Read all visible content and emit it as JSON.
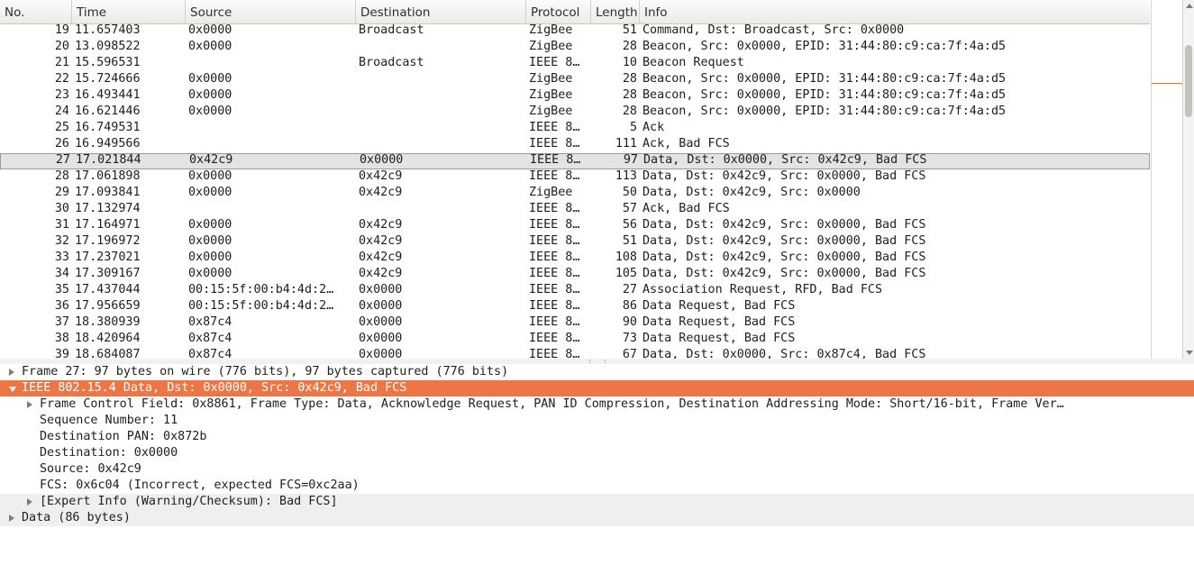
{
  "columns": {
    "no": "No.",
    "time": "Time",
    "source": "Source",
    "destination": "Destination",
    "protocol": "Protocol",
    "length": "Length",
    "info": "Info"
  },
  "packets": [
    {
      "no": "19",
      "time": "11.657403",
      "src": "0x0000",
      "dst": "Broadcast",
      "proto": "ZigBee",
      "len": "51",
      "info": "Command, Dst: Broadcast, Src: 0x0000"
    },
    {
      "no": "20",
      "time": "13.098522",
      "src": "0x0000",
      "dst": "",
      "proto": "ZigBee",
      "len": "28",
      "info": "Beacon, Src: 0x0000, EPID: 31:44:80:c9:ca:7f:4a:d5"
    },
    {
      "no": "21",
      "time": "15.596531",
      "src": "",
      "dst": "Broadcast",
      "proto": "IEEE 8…",
      "len": "10",
      "info": "Beacon Request"
    },
    {
      "no": "22",
      "time": "15.724666",
      "src": "0x0000",
      "dst": "",
      "proto": "ZigBee",
      "len": "28",
      "info": "Beacon, Src: 0x0000, EPID: 31:44:80:c9:ca:7f:4a:d5"
    },
    {
      "no": "23",
      "time": "16.493441",
      "src": "0x0000",
      "dst": "",
      "proto": "ZigBee",
      "len": "28",
      "info": "Beacon, Src: 0x0000, EPID: 31:44:80:c9:ca:7f:4a:d5"
    },
    {
      "no": "24",
      "time": "16.621446",
      "src": "0x0000",
      "dst": "",
      "proto": "ZigBee",
      "len": "28",
      "info": "Beacon, Src: 0x0000, EPID: 31:44:80:c9:ca:7f:4a:d5"
    },
    {
      "no": "25",
      "time": "16.749531",
      "src": "",
      "dst": "",
      "proto": "IEEE 8…",
      "len": "5",
      "info": "Ack"
    },
    {
      "no": "26",
      "time": "16.949566",
      "src": "",
      "dst": "",
      "proto": "IEEE 8…",
      "len": "111",
      "info": "Ack, Bad FCS"
    },
    {
      "no": "27",
      "time": "17.021844",
      "src": "0x42c9",
      "dst": "0x0000",
      "proto": "IEEE 8…",
      "len": "97",
      "info": "Data, Dst: 0x0000, Src: 0x42c9, Bad FCS",
      "selected": true
    },
    {
      "no": "28",
      "time": "17.061898",
      "src": "0x0000",
      "dst": "0x42c9",
      "proto": "IEEE 8…",
      "len": "113",
      "info": "Data, Dst: 0x42c9, Src: 0x0000, Bad FCS"
    },
    {
      "no": "29",
      "time": "17.093841",
      "src": "0x0000",
      "dst": "0x42c9",
      "proto": "ZigBee",
      "len": "50",
      "info": "Data, Dst: 0x42c9, Src: 0x0000"
    },
    {
      "no": "30",
      "time": "17.132974",
      "src": "",
      "dst": "",
      "proto": "IEEE 8…",
      "len": "57",
      "info": "Ack, Bad FCS"
    },
    {
      "no": "31",
      "time": "17.164971",
      "src": "0x0000",
      "dst": "0x42c9",
      "proto": "IEEE 8…",
      "len": "56",
      "info": "Data, Dst: 0x42c9, Src: 0x0000, Bad FCS"
    },
    {
      "no": "32",
      "time": "17.196972",
      "src": "0x0000",
      "dst": "0x42c9",
      "proto": "IEEE 8…",
      "len": "51",
      "info": "Data, Dst: 0x42c9, Src: 0x0000, Bad FCS"
    },
    {
      "no": "33",
      "time": "17.237021",
      "src": "0x0000",
      "dst": "0x42c9",
      "proto": "IEEE 8…",
      "len": "108",
      "info": "Data, Dst: 0x42c9, Src: 0x0000, Bad FCS"
    },
    {
      "no": "34",
      "time": "17.309167",
      "src": "0x0000",
      "dst": "0x42c9",
      "proto": "IEEE 8…",
      "len": "105",
      "info": "Data, Dst: 0x42c9, Src: 0x0000, Bad FCS"
    },
    {
      "no": "35",
      "time": "17.437044",
      "src": "00:15:5f:00:b4:4d:2…",
      "dst": "0x0000",
      "proto": "IEEE 8…",
      "len": "27",
      "info": "Association Request, RFD, Bad FCS"
    },
    {
      "no": "36",
      "time": "17.956659",
      "src": "00:15:5f:00:b4:4d:2…",
      "dst": "0x0000",
      "proto": "IEEE 8…",
      "len": "86",
      "info": "Data Request, Bad FCS"
    },
    {
      "no": "37",
      "time": "18.380939",
      "src": "0x87c4",
      "dst": "0x0000",
      "proto": "IEEE 8…",
      "len": "90",
      "info": "Data Request, Bad FCS"
    },
    {
      "no": "38",
      "time": "18.420964",
      "src": "0x87c4",
      "dst": "0x0000",
      "proto": "IEEE 8…",
      "len": "73",
      "info": "Data Request, Bad FCS"
    },
    {
      "no": "39",
      "time": "18.684087",
      "src": "0x87c4",
      "dst": "0x0000",
      "proto": "IEEE 8…",
      "len": "67",
      "info": "Data, Dst: 0x0000, Src: 0x87c4, Bad FCS"
    }
  ],
  "details": [
    {
      "text": "Frame 27: 97 bytes on wire (776 bits), 97 bytes captured (776 bits)",
      "level": 0,
      "expander": "collapsed"
    },
    {
      "text": "IEEE 802.15.4 Data, Dst: 0x0000, Src: 0x42c9, Bad FCS",
      "level": 0,
      "expander": "expanded",
      "highlight": true
    },
    {
      "text": "Frame Control Field: 0x8861, Frame Type: Data, Acknowledge Request, PAN ID Compression, Destination Addressing Mode: Short/16-bit, Frame Ver…",
      "level": 1,
      "expander": "collapsed"
    },
    {
      "text": "Sequence Number: 11",
      "level": 1,
      "expander": "none"
    },
    {
      "text": "Destination PAN: 0x872b",
      "level": 1,
      "expander": "none"
    },
    {
      "text": "Destination: 0x0000",
      "level": 1,
      "expander": "none"
    },
    {
      "text": "Source: 0x42c9",
      "level": 1,
      "expander": "none"
    },
    {
      "text": "FCS: 0x6c04 (Incorrect, expected FCS=0xc2aa)",
      "level": 1,
      "expander": "none"
    },
    {
      "text": "[Expert Info (Warning/Checksum): Bad FCS]",
      "level": 1,
      "expander": "collapsed",
      "alt": true
    },
    {
      "text": "Data (86 bytes)",
      "level": 0,
      "expander": "collapsed",
      "alt": true
    }
  ],
  "colors": {
    "selected_row_bg": "#e4e3e1",
    "highlight_bg": "#ec7645",
    "minimap_marker": "#e3733d"
  }
}
